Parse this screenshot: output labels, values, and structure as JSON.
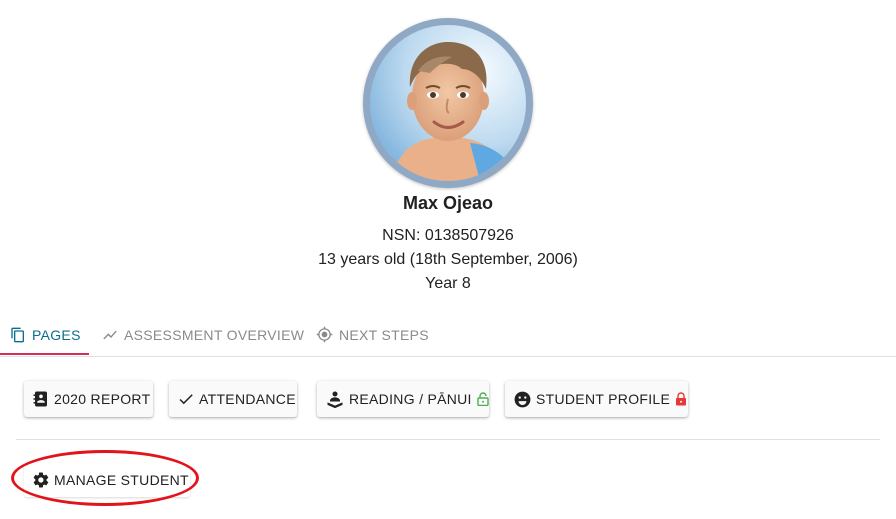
{
  "student": {
    "name": "Max Ojeao",
    "nsn": "NSN: 0138507926",
    "age": "13 years old (18th September, 2006)",
    "year": "Year 8"
  },
  "tabs": [
    {
      "label": "PAGES",
      "icon": "copy-pages-icon",
      "active": true
    },
    {
      "label": "ASSESSMENT OVERVIEW",
      "icon": "trending-line-icon",
      "active": false
    },
    {
      "label": "NEXT STEPS",
      "icon": "crosshair-icon",
      "active": false
    }
  ],
  "pages": [
    {
      "label": "2020 REPORT",
      "icon": "contact-book-icon",
      "locked": false
    },
    {
      "label": "ATTENDANCE",
      "icon": "check-icon",
      "locked": false
    },
    {
      "label": "READING / PĀNUI",
      "icon": "reader-icon",
      "locked": true,
      "lock_state": "unlocked",
      "lock_color": "#4caf50"
    },
    {
      "label": "STUDENT PROFILE",
      "icon": "smiley-icon",
      "locked": true,
      "lock_state": "locked",
      "lock_color": "#e53935"
    }
  ],
  "manage": {
    "label": "MANAGE STUDENT",
    "icon": "gear-icon"
  },
  "colors": {
    "accent_tab": "#0a6e8f",
    "tab_underline": "#d32f5a",
    "highlight_ring": "#e3131b"
  }
}
